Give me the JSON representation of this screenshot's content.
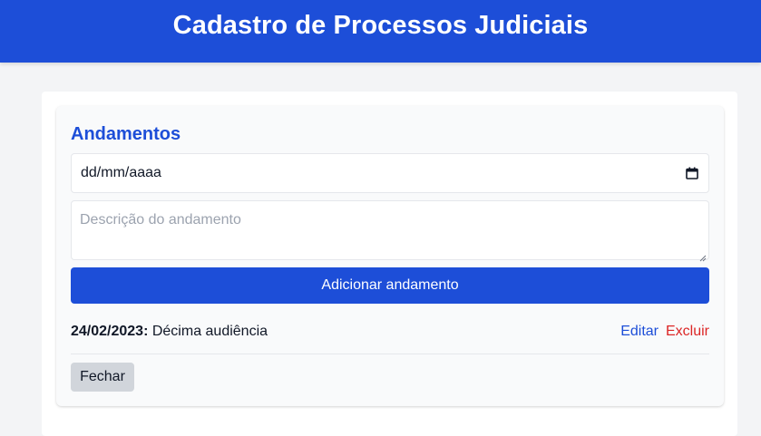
{
  "header": {
    "title": "Cadastro de Processos Judiciais"
  },
  "panel": {
    "title": "Andamentos",
    "date_input": {
      "value": "dd/mm/aaaa",
      "icon": "calendar-icon"
    },
    "description_input": {
      "placeholder": "Descrição do andamento",
      "value": ""
    },
    "add_button_label": "Adicionar andamento",
    "entries": [
      {
        "date": "24/02/2023:",
        "description": " Décima audiência",
        "edit_label": "Editar",
        "delete_label": "Excluir"
      }
    ],
    "close_button_label": "Fechar"
  },
  "colors": {
    "primary": "#1d4ed8",
    "danger": "#dc2626",
    "background": "#f3f4f6",
    "secondary_button": "#d1d5db"
  }
}
